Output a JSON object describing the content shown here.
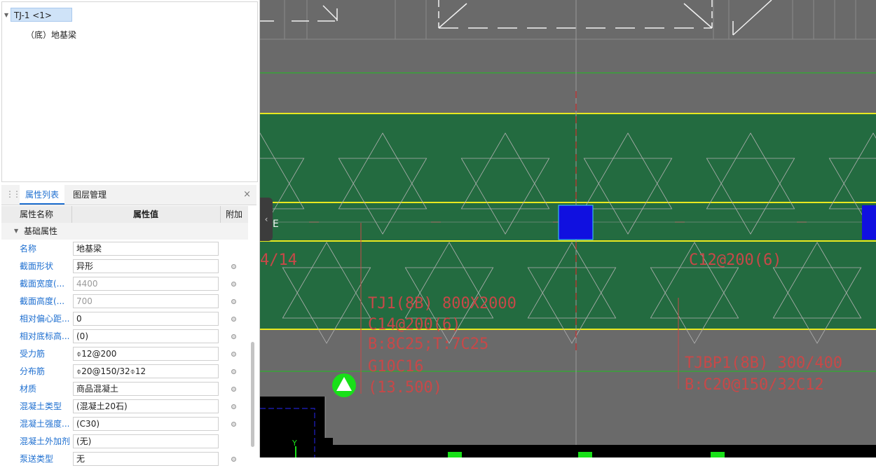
{
  "tree": {
    "root_label": "TJ-1 <1>",
    "child_label": "（底）地基梁"
  },
  "panel": {
    "tabs": [
      {
        "label": "属性列表",
        "active": true
      },
      {
        "label": "图层管理",
        "active": false
      }
    ],
    "close_label": "×",
    "columns": {
      "name": "属性名称",
      "value": "属性值",
      "extra": "附加"
    },
    "group_label": "基础属性",
    "rows": [
      {
        "label": "名称",
        "value": "地基梁",
        "gray": false,
        "dot": false
      },
      {
        "label": "截面形状",
        "value": "异形",
        "gray": false,
        "dot": true
      },
      {
        "label": "截面宽度(...",
        "value": "4400",
        "gray": true,
        "dot": true
      },
      {
        "label": "截面高度(...",
        "value": "700",
        "gray": true,
        "dot": true
      },
      {
        "label": "相对偏心距...",
        "value": "0",
        "gray": false,
        "dot": true
      },
      {
        "label": "相对底标高...",
        "value": "(0)",
        "gray": false,
        "dot": true
      },
      {
        "label": "受力筋",
        "value": "⌽12@200",
        "gray": false,
        "dot": true
      },
      {
        "label": "分布筋",
        "value": "⌽20@150/32⌽12",
        "gray": false,
        "dot": true
      },
      {
        "label": "材质",
        "value": "商品混凝土",
        "gray": false,
        "dot": true
      },
      {
        "label": "混凝土类型",
        "value": "(混凝土20石)",
        "gray": false,
        "dot": true
      },
      {
        "label": "混凝土强度...",
        "value": "(C30)",
        "gray": false,
        "dot": true
      },
      {
        "label": "混凝土外加剂",
        "value": "(无)",
        "gray": false,
        "dot": false
      },
      {
        "label": "泵送类型",
        "value": "无",
        "gray": false,
        "dot": true
      }
    ]
  },
  "canvas": {
    "colors": {
      "background": "#6a6a6a",
      "beam": "#236b40",
      "edge": "#e8e820",
      "annotation": "#c84848",
      "column": "#1010e0",
      "marker": "#18e018"
    },
    "annotations": {
      "left_fragment": "4/14",
      "stirrup_right": "C12@200(6)",
      "beam_line1": "TJ1(8B) 800X2000",
      "beam_line2": "C14@200(6)",
      "beam_line3": "B:8C25;T:7C25",
      "beam_line4": "G10C16",
      "beam_line5": "(13.500)",
      "slab_line1": "TJBP1(8B) 300/400",
      "slab_line2": "B:C20@150/32C12",
      "axis_label": "E",
      "y_axis_label": "Y"
    },
    "collapse_icon": "chevron-left-icon"
  }
}
